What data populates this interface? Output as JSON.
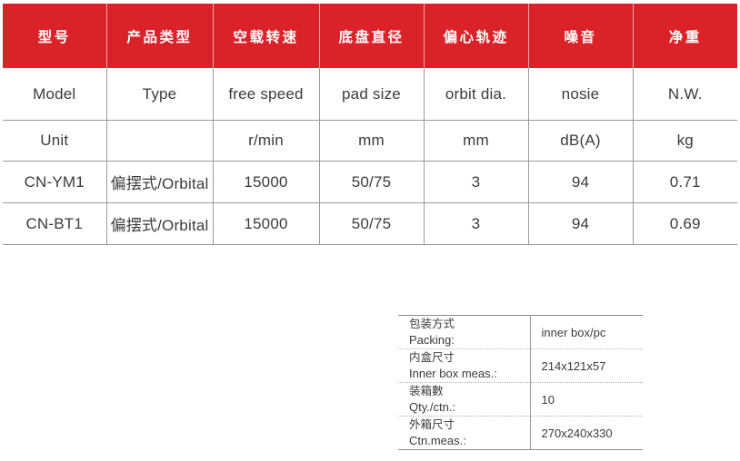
{
  "theme": {
    "header_bg": "#dc2229",
    "header_text": "#ffffff",
    "grid_line": "#9a9a9a",
    "body_text": "#3b3b3b"
  },
  "spec_table": {
    "headers_cn": [
      "型号",
      "产品类型",
      "空载转速",
      "底盘直径",
      "偏心轨迹",
      "噪音",
      "净重"
    ],
    "rows": [
      {
        "name": "label-row",
        "cells": [
          "Model",
          "Type",
          "free speed",
          "pad size",
          "orbit dia.",
          "nosie",
          "N.W."
        ]
      },
      {
        "name": "unit-row",
        "cells": [
          "Unit",
          "",
          "r/min",
          "mm",
          "mm",
          "dB(A)",
          "kg"
        ]
      },
      {
        "name": "model-cn-ym1-row",
        "cells": [
          "CN-YM1",
          "偏摆式/Orbital",
          "15000",
          "50/75",
          "3",
          "94",
          "0.71"
        ]
      },
      {
        "name": "model-cn-bt1-row",
        "cells": [
          "CN-BT1",
          "偏摆式/Orbital",
          "15000",
          "50/75",
          "3",
          "94",
          "0.69"
        ]
      }
    ]
  },
  "packing_table": {
    "rows": [
      {
        "label_cn": "包装方式",
        "label_en": "Packing:",
        "value": "inner box/pc"
      },
      {
        "label_cn": "内盒尺寸",
        "label_en": "Inner box meas.:",
        "value": "214x121x57"
      },
      {
        "label_cn": "装箱數",
        "label_en": "Qty./ctn.:",
        "value": "10"
      },
      {
        "label_cn": "外箱尺寸",
        "label_en": "Ctn.meas.:",
        "value": "270x240x330"
      }
    ]
  }
}
